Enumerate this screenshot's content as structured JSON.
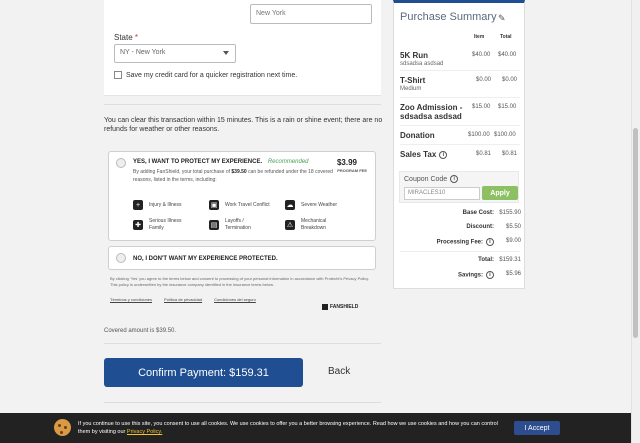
{
  "billing": {
    "city_placeholder": "New York",
    "state_label": "State",
    "state_required_mark": "*",
    "state_value": "NY - New York",
    "save_card_label": "Save my credit card for a quicker registration next time."
  },
  "notice_text": "You can clear this transaction within 15 minutes. This is a rain or shine event; there are no refunds for weather or other reasons.",
  "protection": {
    "yes_title": "YES, I WANT TO PROTECT MY EXPERIENCE.",
    "recommended": "Recommended",
    "price": "$3.99",
    "price_sub": "PROGRAM FEE",
    "desc_before": "By adding FanShield, your total purchase of",
    "desc_amount": "$39.50",
    "desc_after": "can be refunded under the 18 covered reasons, listed in the terms, including:",
    "reasons": [
      {
        "label": "Injury & Illness",
        "icon": "medical-cross-icon"
      },
      {
        "label": "Work Travel Conflict",
        "icon": "briefcase-icon"
      },
      {
        "label": "Severe Weather",
        "icon": "storm-cloud-icon"
      },
      {
        "label": "Serious Illness Family",
        "icon": "bandage-icon"
      },
      {
        "label": "Layoffs / Termination",
        "icon": "layoff-box-icon"
      },
      {
        "label": "Mechanical Breakdown",
        "icon": "car-breakdown-icon"
      }
    ],
    "no_title": "NO, I DON'T WANT MY EXPERIENCE PROTECTED.",
    "legal": "By clicking 'Yes' you agree to the terms below and consent to processing of your personal information in accordance with Protecht's Privacy Policy. This policy is underwritten by the insurance company identified in the insurance terms below.",
    "links": [
      "Términos y condiciones",
      "Política de privacidad",
      "Condiciones del seguro"
    ],
    "brand": "FANSHIELD"
  },
  "covered_amount": "Covered amount is $39.50.",
  "actions": {
    "confirm_label": "Confirm Payment: $159.31",
    "back_label": "Back"
  },
  "summary": {
    "title": "Purchase Summary",
    "col_item": "Item",
    "col_total": "Total",
    "items": [
      {
        "name": "5K Run",
        "sub": "sdsadsa asdsad",
        "item": "$40.00",
        "total": "$40.00"
      },
      {
        "name": "T-Shirt",
        "sub": "Medium",
        "item": "$0.00",
        "total": "$0.00"
      },
      {
        "name": "Zoo Admission -",
        "sub": "sdsadsa asdsad",
        "item": "$15.00",
        "total": "$15.00"
      },
      {
        "name": "Donation",
        "sub": "",
        "item": "$100.00",
        "total": "$100.00"
      },
      {
        "name": "Sales Tax",
        "sub": "",
        "item": "$0.81",
        "total": "$0.81"
      }
    ],
    "coupon_label": "Coupon Code",
    "coupon_value": "MIRACLES10",
    "apply_label": "Apply",
    "totals": [
      {
        "label": "Base Cost:",
        "value": "$155.90",
        "info": false
      },
      {
        "label": "Discount:",
        "value": "$5.50",
        "info": false
      },
      {
        "label": "Processing Fee:",
        "value": "$9.00",
        "info": true
      },
      {
        "label": "Total:",
        "value": "$159.31",
        "info": false
      },
      {
        "label": "Savings:",
        "value": "$5.96",
        "info": true
      }
    ]
  },
  "cookie": {
    "text": "If you continue to use this site, you consent to use all cookies. We use cookies to offer you a better browsing experience. Read how we use cookies and how you can control them by visiting our",
    "policy_link": "Privacy Policy.",
    "accept_label": "I Accept"
  },
  "colors": {
    "brand_blue": "#1f4e92",
    "apply_green": "#8cc063",
    "recommended_green": "#4aa05a"
  }
}
